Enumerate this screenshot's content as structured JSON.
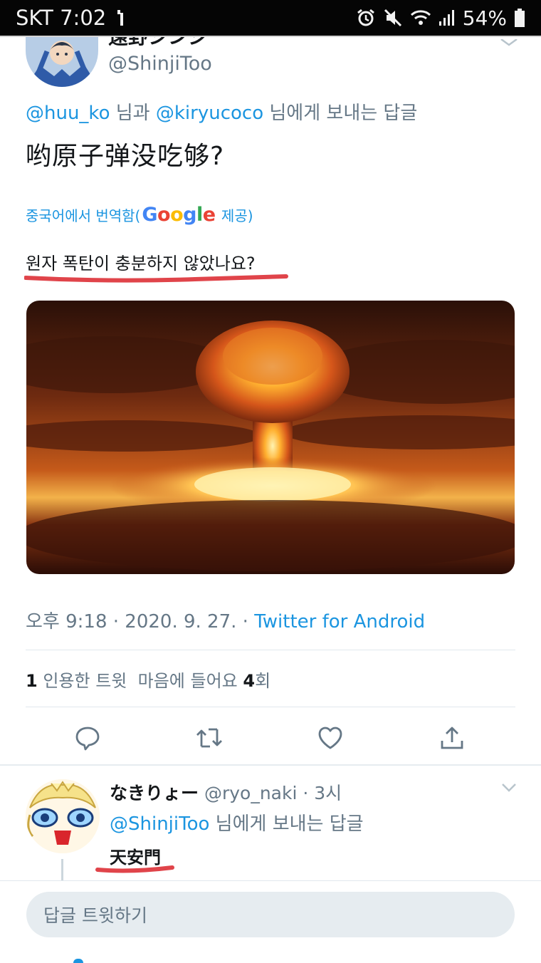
{
  "status_bar": {
    "carrier_time": "SKT 7:02",
    "battery": "54%",
    "icons": [
      "notification-icon",
      "alarm-icon",
      "mute-icon",
      "wifi-icon",
      "signal-icon",
      "battery-icon"
    ]
  },
  "main_tweet": {
    "display_name": "遠野シンジ",
    "handle": "@ShinjiToo",
    "reply_to": {
      "user1": "@huu_ko",
      "connector": " 님과 ",
      "user2": "@kiryucoco",
      "suffix": " 님에게 보내는 답글"
    },
    "text": "哟原子弹没吃够?",
    "translated_by": {
      "prefix": "중국어에서 번역함(",
      "google": "Google",
      "suffix": " 제공)"
    },
    "translation": "원자 폭탄이 충분하지 않았나요?",
    "timestamp": {
      "time_date": "오후 9:18 · 2020. 9. 27. · ",
      "client": "Twitter for Android"
    },
    "stats": {
      "quote_count": "1",
      "quote_label": "인용한 트윗",
      "likes_label": "마음에 들어요",
      "likes_count": "4",
      "likes_unit": "회"
    },
    "actions": [
      "reply-icon",
      "retweet-icon",
      "like-icon",
      "share-icon"
    ]
  },
  "reply_tweet": {
    "display_name": "なきりょー",
    "handle_meta": "@ryo_naki · 3시",
    "reply_to_user": "@ShinjiToo",
    "reply_to_suffix": " 님에게 보내는 답글",
    "text": "天安門"
  },
  "composer": {
    "placeholder": "답글 트윗하기"
  },
  "colors": {
    "link_blue": "#1b95e0",
    "secondary_text": "#657786",
    "annotation_red": "#e0444a",
    "composer_bg": "#e6ecf0"
  }
}
